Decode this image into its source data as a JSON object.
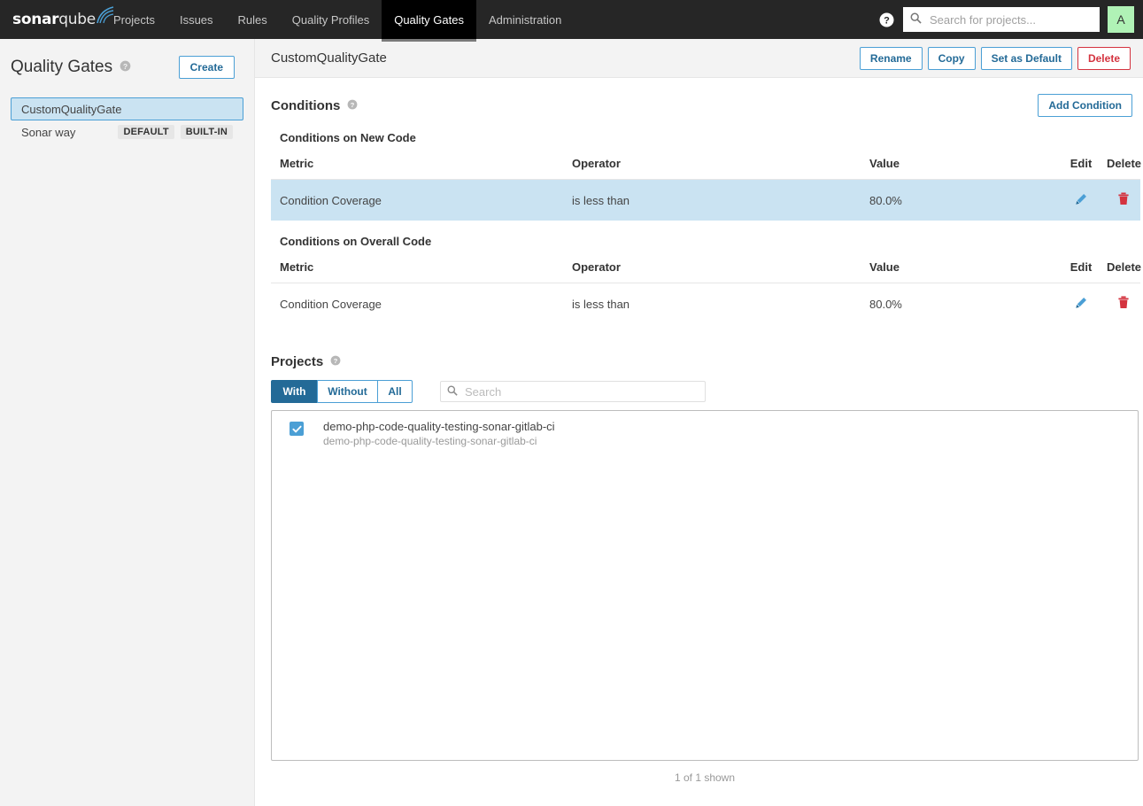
{
  "navbar": {
    "logo": {
      "bold": "sonar",
      "light": "qube",
      "icon": "sonarqube-logo"
    },
    "links": [
      {
        "label": "Projects",
        "active": false
      },
      {
        "label": "Issues",
        "active": false
      },
      {
        "label": "Rules",
        "active": false
      },
      {
        "label": "Quality Profiles",
        "active": false
      },
      {
        "label": "Quality Gates",
        "active": true
      },
      {
        "label": "Administration",
        "active": false
      }
    ],
    "help_icon": "help-circle-icon",
    "search": {
      "placeholder": "Search for projects...",
      "value": "",
      "icon": "search-icon"
    },
    "avatar": {
      "initial": "A",
      "color": "#b0f2b6"
    }
  },
  "sidebar": {
    "title": "Quality Gates",
    "help_icon": "help-circle-icon",
    "create_label": "Create",
    "gates": [
      {
        "name": "CustomQualityGate",
        "selected": true,
        "badges": []
      },
      {
        "name": "Sonar way",
        "selected": false,
        "badges": [
          "DEFAULT",
          "BUILT-IN"
        ]
      }
    ]
  },
  "main": {
    "title": "CustomQualityGate",
    "actions": [
      {
        "label": "Rename",
        "style": "primary"
      },
      {
        "label": "Copy",
        "style": "primary"
      },
      {
        "label": "Set as Default",
        "style": "primary"
      },
      {
        "label": "Delete",
        "style": "danger"
      }
    ],
    "conditions": {
      "title": "Conditions",
      "help_icon": "help-circle-icon",
      "add_label": "Add Condition",
      "columns": [
        "Metric",
        "Operator",
        "Value",
        "Edit",
        "Delete"
      ],
      "groups": [
        {
          "title": "Conditions on New Code",
          "rows": [
            {
              "metric": "Condition Coverage",
              "operator": "is less than",
              "value": "80.0%",
              "highlighted": true
            }
          ]
        },
        {
          "title": "Conditions on Overall Code",
          "rows": [
            {
              "metric": "Condition Coverage",
              "operator": "is less than",
              "value": "80.0%",
              "highlighted": false
            }
          ]
        }
      ]
    },
    "projects": {
      "title": "Projects",
      "help_icon": "help-circle-icon",
      "filters": [
        {
          "label": "With",
          "active": true
        },
        {
          "label": "Without",
          "active": false
        },
        {
          "label": "All",
          "active": false
        }
      ],
      "search": {
        "placeholder": "Search",
        "value": "",
        "icon": "search-icon"
      },
      "items": [
        {
          "name": "demo-php-code-quality-testing-sonar-gitlab-ci",
          "key": "demo-php-code-quality-testing-sonar-gitlab-ci",
          "checked": true
        }
      ],
      "shown_note": "1 of 1 shown"
    }
  },
  "colors": {
    "accent_blue": "#4b9fd5",
    "link_blue": "#236a97",
    "danger_red": "#d4333f",
    "row_highlight": "#cae3f2",
    "navbar_bg": "#262626"
  }
}
